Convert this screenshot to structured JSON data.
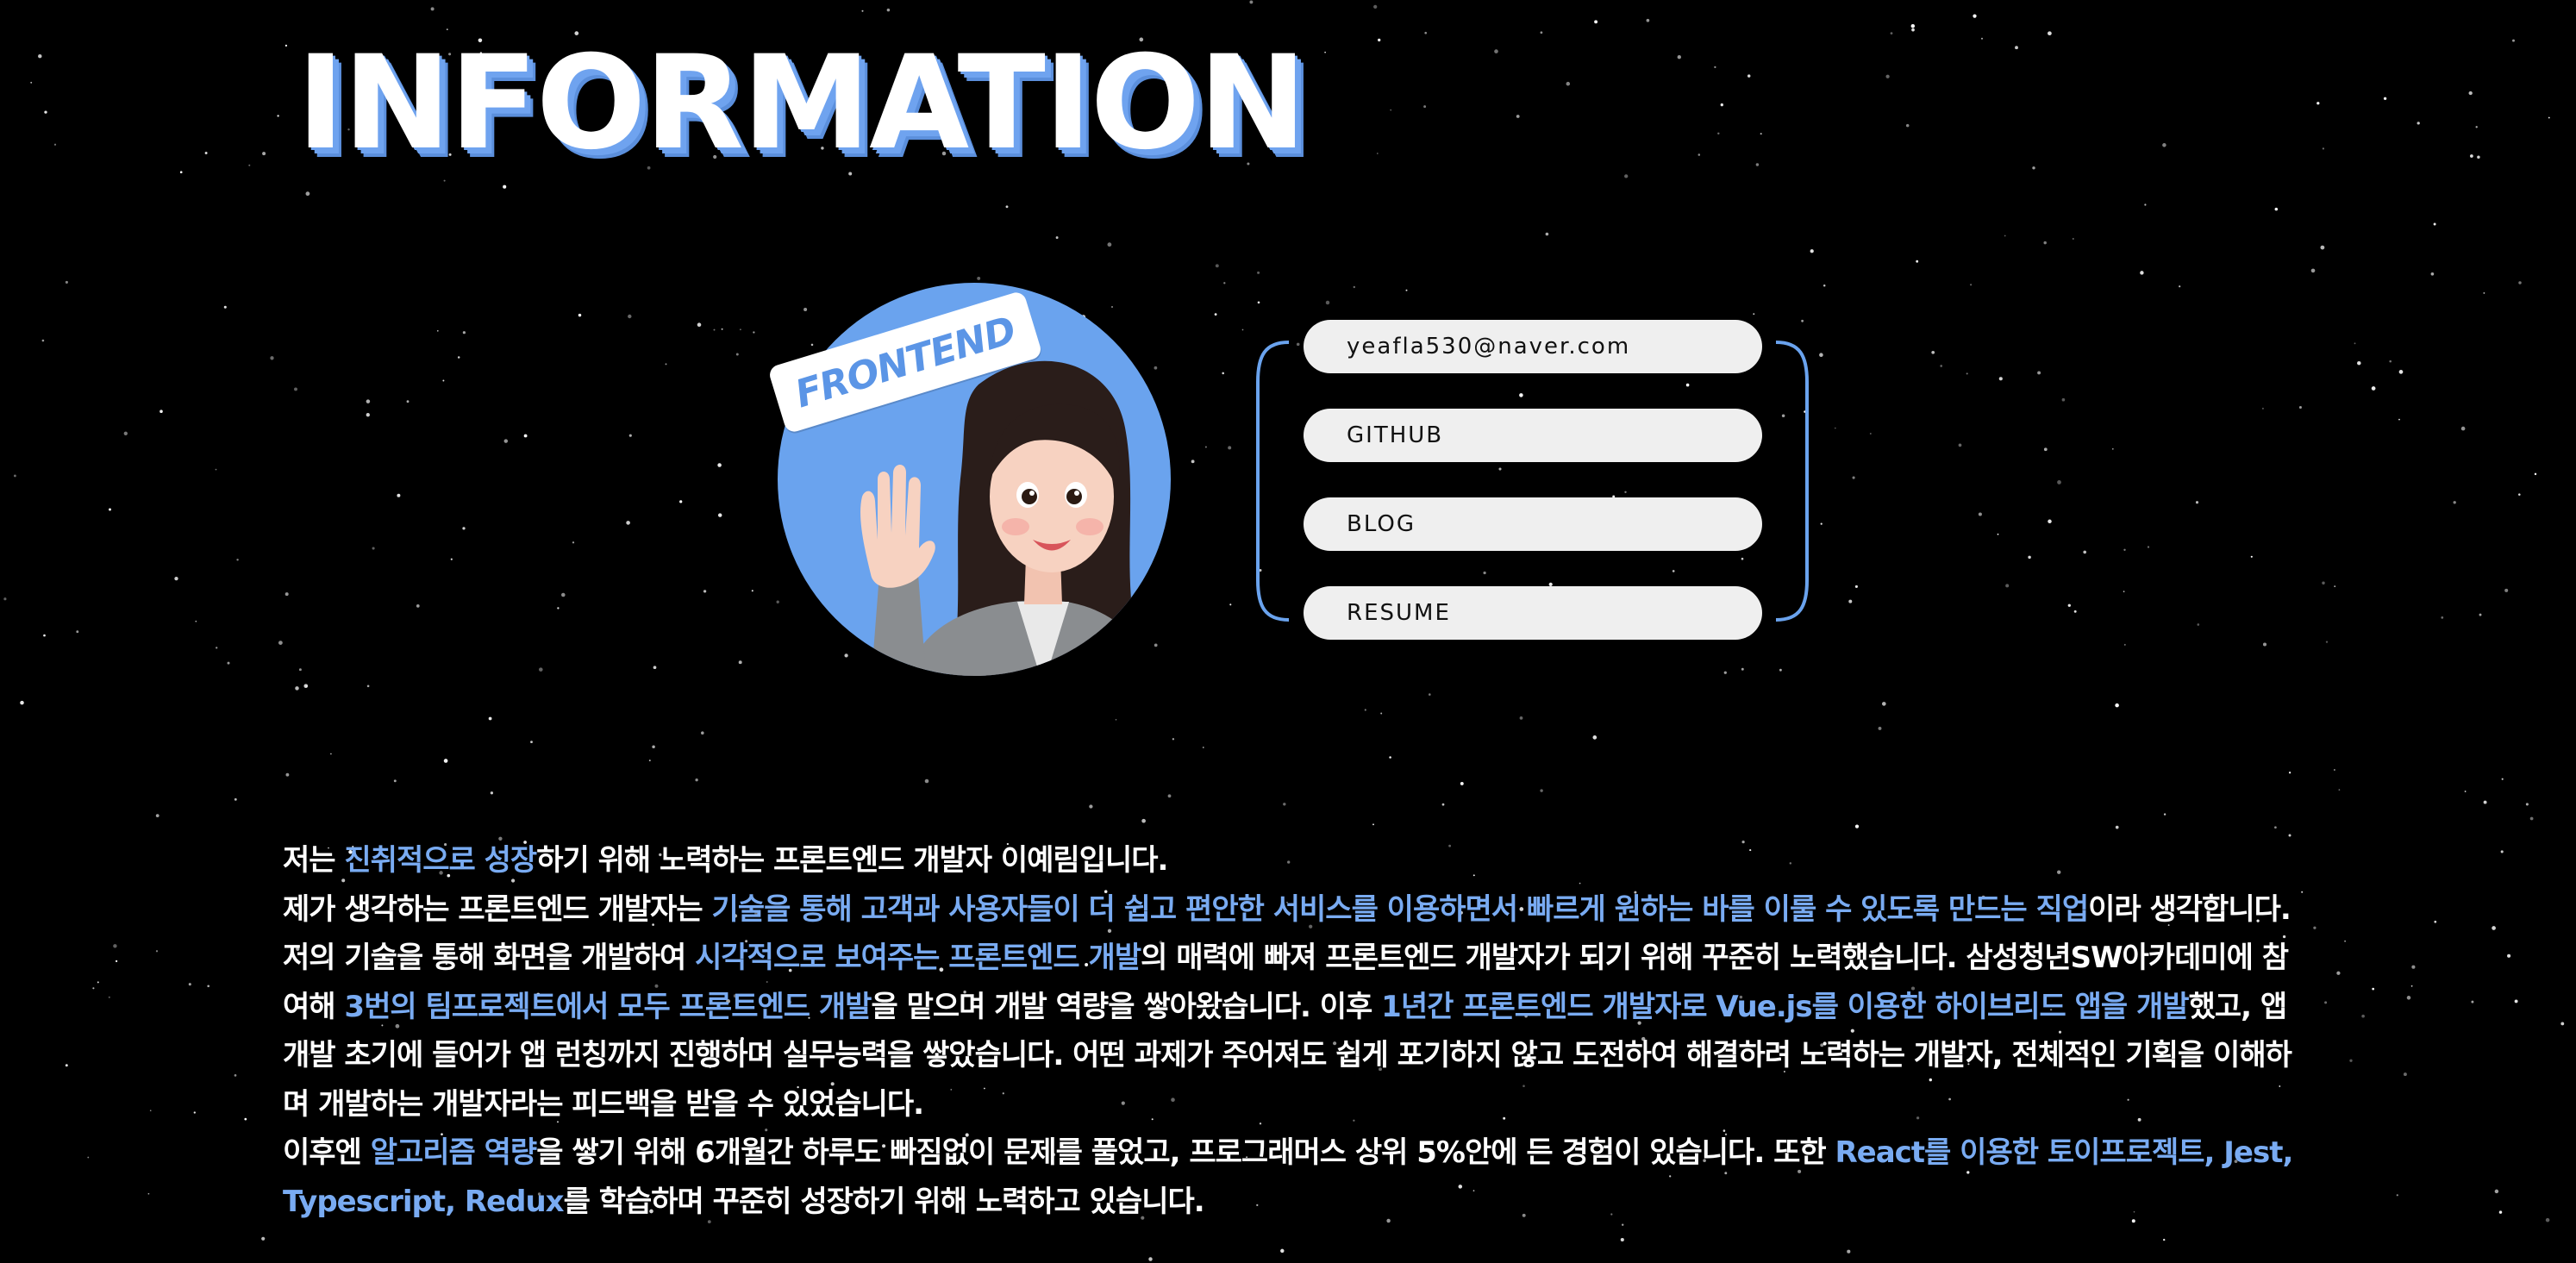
{
  "header": {
    "title": "INFORMATION"
  },
  "profile": {
    "badge": "FRONTEND"
  },
  "links": [
    {
      "label": "yeafla530@naver.com"
    },
    {
      "label": "GITHUB"
    },
    {
      "label": "BLOG"
    },
    {
      "label": "RESUME"
    }
  ],
  "about": {
    "segments": [
      {
        "text": "저는 ",
        "highlight": false
      },
      {
        "text": "진취적으로 성장",
        "highlight": true
      },
      {
        "text": "하기 위해 노력하는 프론트엔드 개발자 이예림입니다.",
        "highlight": false
      },
      {
        "br": true
      },
      {
        "text": "제가 생각하는 프론트엔드 개발자는 ",
        "highlight": false
      },
      {
        "text": "기술을 통해 고객과 사용자들이 더 쉽고 편안한 서비스를 이용하면서 빠르게 원하는 바를 이룰 수 있도록 만드는 직업",
        "highlight": true
      },
      {
        "text": "이라 생각합니다. 저의 기술을 통해 화면을 개발하여 ",
        "highlight": false
      },
      {
        "text": "시각적으로 보여주는 프론트엔드 개발",
        "highlight": true
      },
      {
        "text": "의 매력에 빠져 프론트엔드 개발자가 되기 위해 꾸준히 노력했습니다. 삼성청년SW아카데미에 참여해 ",
        "highlight": false
      },
      {
        "text": "3번의 팀프로젝트에서 모두 프론트엔드 개발",
        "highlight": true
      },
      {
        "text": "을 맡으며 개발 역량을 쌓아왔습니다. 이후 ",
        "highlight": false
      },
      {
        "text": "1년간 프론트엔드 개발자로 Vue.js를 이용한 하이브리드 앱을 개발",
        "highlight": true
      },
      {
        "text": "했고, 앱개발 초기에 들어가 앱 런칭까지 진행하며 실무능력을 쌓았습니다. 어떤 과제가 주어져도 쉽게 포기하지 않고 도전하여 해결하려 노력하는 개발자, 전체적인 기획을 이해하며 개발하는 개발자라는 피드백을 받을 수 있었습니다.",
        "highlight": false
      },
      {
        "br": true
      },
      {
        "text": "이후엔 ",
        "highlight": false
      },
      {
        "text": "알고리즘 역량",
        "highlight": true
      },
      {
        "text": "을 쌓기 위해 6개월간 하루도 빠짐없이 문제를 풀었고, 프로그래머스 상위 5%안에 든 경험이 있습니다. 또한 ",
        "highlight": false
      },
      {
        "text": "React를 이용한 토이프로젝트, Jest,Typescript, Redux",
        "highlight": true
      },
      {
        "text": "를 학습하며 꾸준히 성장하기 위해 노력하고 있습니다.",
        "highlight": false
      }
    ]
  },
  "colors": {
    "background": "#000000",
    "accent": "#6fa3ef",
    "highlight_text": "#79abf2",
    "pill_bg": "#efefef"
  }
}
